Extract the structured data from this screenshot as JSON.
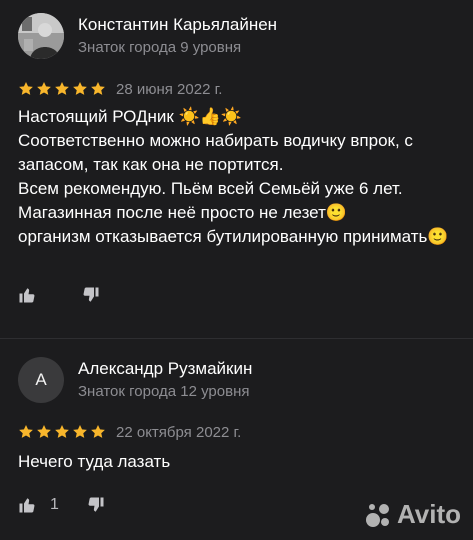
{
  "reviews": [
    {
      "author": "Константин Карьялайнен",
      "level": "Знаток города 9 уровня",
      "rating": 5,
      "date": "28 июня 2022 г.",
      "text": "Настоящий РОДник ☀️👍☀️\nСоответственно можно набирать водичку впрок, с запасом, так как она не портится.\nВсем рекомендую. Пьём всей Семьёй уже 6 лет. Магазинная после неё просто не лезет🙂\nорганизм отказывается бутилированную принимать🙂",
      "avatar_icon": "person-photo-icon"
    },
    {
      "author": "Александр Рузмайкин",
      "level": "Знаток города 12 уровня",
      "avatar_letter": "А",
      "rating": 5,
      "date": "22 октября 2022 г.",
      "text": "Нечего туда лазать",
      "likes": "1"
    }
  ],
  "colors": {
    "background": "#1c1c1e",
    "star": "#f8b62c",
    "secondary_text": "#8d8d92"
  },
  "watermark": {
    "text": "Avito",
    "icon": "avito-logo-icon"
  }
}
